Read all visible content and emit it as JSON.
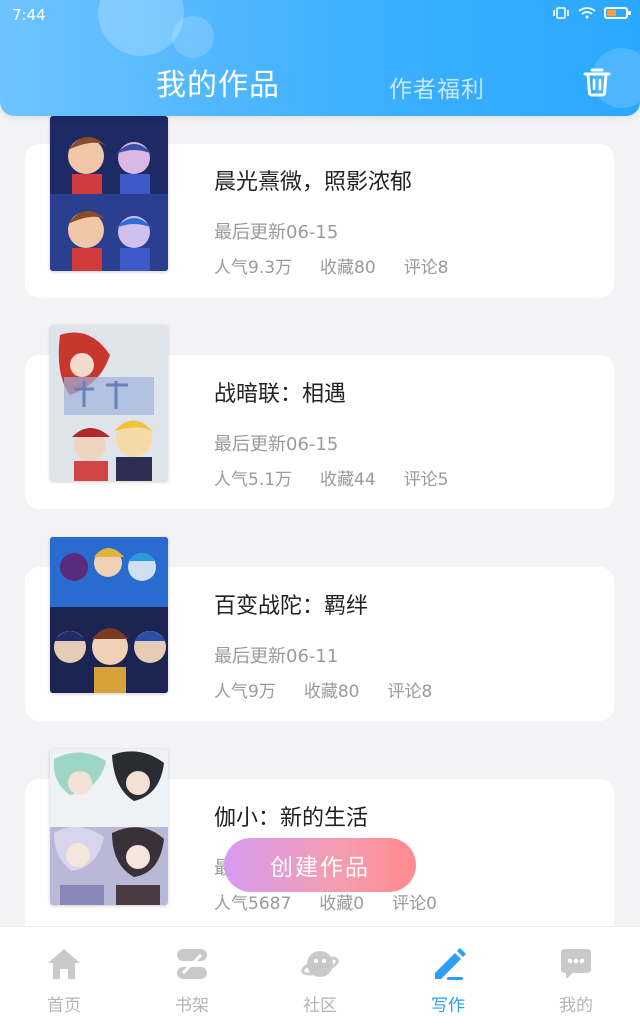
{
  "status_bar": {
    "time": "7:44"
  },
  "header": {
    "tab_my_works": "我的作品",
    "tab_author_benefits": "作者福利",
    "trash_icon": "trash-icon",
    "colors": {
      "start": "#6fc3ff",
      "end": "#2aa8ff"
    }
  },
  "works": [
    {
      "title": "晨光熹微，照影浓郁",
      "updated": "最后更新06-15",
      "popularity": "人气9.3万",
      "favorites": "收藏80",
      "comments": "评论8"
    },
    {
      "title": "战暗联：相遇",
      "updated": "最后更新06-15",
      "popularity": "人气5.1万",
      "favorites": "收藏44",
      "comments": "评论5"
    },
    {
      "title": "百变战陀：羁绊",
      "updated": "最后更新06-11",
      "popularity": "人气9万",
      "favorites": "收藏80",
      "comments": "评论8"
    },
    {
      "title": "伽小：新的生活",
      "updated": "最后更新",
      "popularity": "人气5687",
      "favorites": "收藏0",
      "comments": "评论0"
    }
  ],
  "create_button": {
    "label": "创建作品"
  },
  "bottom_nav": [
    {
      "label": "首页",
      "icon": "home-icon"
    },
    {
      "label": "书架",
      "icon": "bookshelf-icon"
    },
    {
      "label": "社区",
      "icon": "community-planet-icon"
    },
    {
      "label": "写作",
      "icon": "pen-icon",
      "active": true
    },
    {
      "label": "我的",
      "icon": "chat-bubble-icon"
    }
  ]
}
